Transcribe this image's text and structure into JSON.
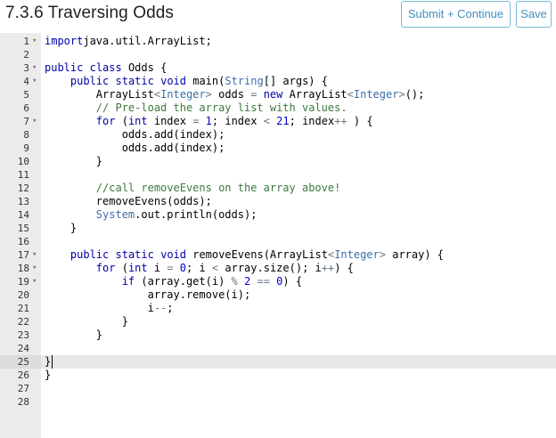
{
  "header": {
    "title": "7.3.6 Traversing Odds",
    "submit_label": "Submit + Continue",
    "save_label": "Save"
  },
  "editor": {
    "active_line": 25,
    "lines": [
      {
        "n": "1",
        "fold": true,
        "tokens": [
          [
            "kw",
            "import"
          ],
          [
            "",
            "java.util.ArrayList;"
          ]
        ]
      },
      {
        "n": "2",
        "fold": false,
        "tokens": []
      },
      {
        "n": "3",
        "fold": true,
        "tokens": [
          [
            "kw",
            "public"
          ],
          [
            "",
            " "
          ],
          [
            "kw",
            "class"
          ],
          [
            "",
            " Odds {"
          ]
        ]
      },
      {
        "n": "4",
        "fold": true,
        "tokens": [
          [
            "",
            "    "
          ],
          [
            "kw",
            "public"
          ],
          [
            "",
            " "
          ],
          [
            "kw",
            "static"
          ],
          [
            "",
            " "
          ],
          [
            "kw",
            "void"
          ],
          [
            "",
            " main("
          ],
          [
            "ty",
            "String"
          ],
          [
            "",
            "[] args) {"
          ]
        ]
      },
      {
        "n": "5",
        "fold": false,
        "tokens": [
          [
            "",
            "        ArrayList"
          ],
          [
            "op",
            "<"
          ],
          [
            "ty",
            "Integer"
          ],
          [
            "op",
            ">"
          ],
          [
            "",
            " odds "
          ],
          [
            "op",
            "="
          ],
          [
            "",
            " "
          ],
          [
            "kw",
            "new"
          ],
          [
            "",
            " ArrayList"
          ],
          [
            "op",
            "<"
          ],
          [
            "ty",
            "Integer"
          ],
          [
            "op",
            ">"
          ],
          [
            "",
            "();"
          ]
        ]
      },
      {
        "n": "6",
        "fold": false,
        "tokens": [
          [
            "",
            "        "
          ],
          [
            "cm",
            "// Pre-load the array list with values."
          ]
        ]
      },
      {
        "n": "7",
        "fold": true,
        "tokens": [
          [
            "",
            "        "
          ],
          [
            "kw",
            "for"
          ],
          [
            "",
            " ("
          ],
          [
            "kw",
            "int"
          ],
          [
            "",
            " index "
          ],
          [
            "op",
            "="
          ],
          [
            "",
            " "
          ],
          [
            "nu",
            "1"
          ],
          [
            "",
            "; index "
          ],
          [
            "op",
            "<"
          ],
          [
            "",
            " "
          ],
          [
            "nu",
            "21"
          ],
          [
            "",
            "; index"
          ],
          [
            "op",
            "++"
          ],
          [
            "",
            " ) {"
          ]
        ]
      },
      {
        "n": "8",
        "fold": false,
        "tokens": [
          [
            "",
            "            odds.add(index);"
          ]
        ]
      },
      {
        "n": "9",
        "fold": false,
        "tokens": [
          [
            "",
            "            odds.add(index);"
          ]
        ]
      },
      {
        "n": "10",
        "fold": false,
        "tokens": [
          [
            "",
            "        }"
          ]
        ]
      },
      {
        "n": "11",
        "fold": false,
        "tokens": []
      },
      {
        "n": "12",
        "fold": false,
        "tokens": [
          [
            "",
            "        "
          ],
          [
            "cm",
            "//call removeEvens on the array above!"
          ]
        ]
      },
      {
        "n": "13",
        "fold": false,
        "tokens": [
          [
            "",
            "        removeEvens(odds);"
          ]
        ]
      },
      {
        "n": "14",
        "fold": false,
        "tokens": [
          [
            "",
            "        "
          ],
          [
            "ty",
            "System"
          ],
          [
            "",
            ".out.println(odds);"
          ]
        ]
      },
      {
        "n": "15",
        "fold": false,
        "tokens": [
          [
            "",
            "    }"
          ]
        ]
      },
      {
        "n": "16",
        "fold": false,
        "tokens": []
      },
      {
        "n": "17",
        "fold": true,
        "tokens": [
          [
            "",
            "    "
          ],
          [
            "kw",
            "public"
          ],
          [
            "",
            " "
          ],
          [
            "kw",
            "static"
          ],
          [
            "",
            " "
          ],
          [
            "kw",
            "void"
          ],
          [
            "",
            " removeEvens(ArrayList"
          ],
          [
            "op",
            "<"
          ],
          [
            "ty",
            "Integer"
          ],
          [
            "op",
            ">"
          ],
          [
            "",
            " array) {"
          ]
        ]
      },
      {
        "n": "18",
        "fold": true,
        "tokens": [
          [
            "",
            "        "
          ],
          [
            "kw",
            "for"
          ],
          [
            "",
            " ("
          ],
          [
            "kw",
            "int"
          ],
          [
            "",
            " i "
          ],
          [
            "op",
            "="
          ],
          [
            "",
            " "
          ],
          [
            "nu",
            "0"
          ],
          [
            "",
            "; i "
          ],
          [
            "op",
            "<"
          ],
          [
            "",
            " array.size(); i"
          ],
          [
            "op",
            "++"
          ],
          [
            "",
            ") {"
          ]
        ]
      },
      {
        "n": "19",
        "fold": true,
        "tokens": [
          [
            "",
            "            "
          ],
          [
            "kw",
            "if"
          ],
          [
            "",
            " (array.get(i) "
          ],
          [
            "op",
            "%"
          ],
          [
            "",
            " "
          ],
          [
            "nu",
            "2"
          ],
          [
            "",
            " "
          ],
          [
            "op",
            "=="
          ],
          [
            "",
            " "
          ],
          [
            "nu",
            "0"
          ],
          [
            "",
            ") {"
          ]
        ]
      },
      {
        "n": "20",
        "fold": false,
        "tokens": [
          [
            "",
            "                array.remove(i);"
          ]
        ]
      },
      {
        "n": "21",
        "fold": false,
        "tokens": [
          [
            "",
            "                i"
          ],
          [
            "op",
            "--"
          ],
          [
            "",
            ";"
          ]
        ]
      },
      {
        "n": "22",
        "fold": false,
        "tokens": [
          [
            "",
            "            }"
          ]
        ]
      },
      {
        "n": "23",
        "fold": false,
        "tokens": [
          [
            "",
            "        }"
          ]
        ]
      },
      {
        "n": "24",
        "fold": false,
        "tokens": []
      },
      {
        "n": "25",
        "fold": false,
        "tokens": [
          [
            "",
            "}"
          ]
        ]
      },
      {
        "n": "26",
        "fold": false,
        "tokens": [
          [
            "",
            "}"
          ]
        ]
      },
      {
        "n": "27",
        "fold": false,
        "tokens": []
      },
      {
        "n": "28",
        "fold": false,
        "tokens": []
      }
    ]
  }
}
